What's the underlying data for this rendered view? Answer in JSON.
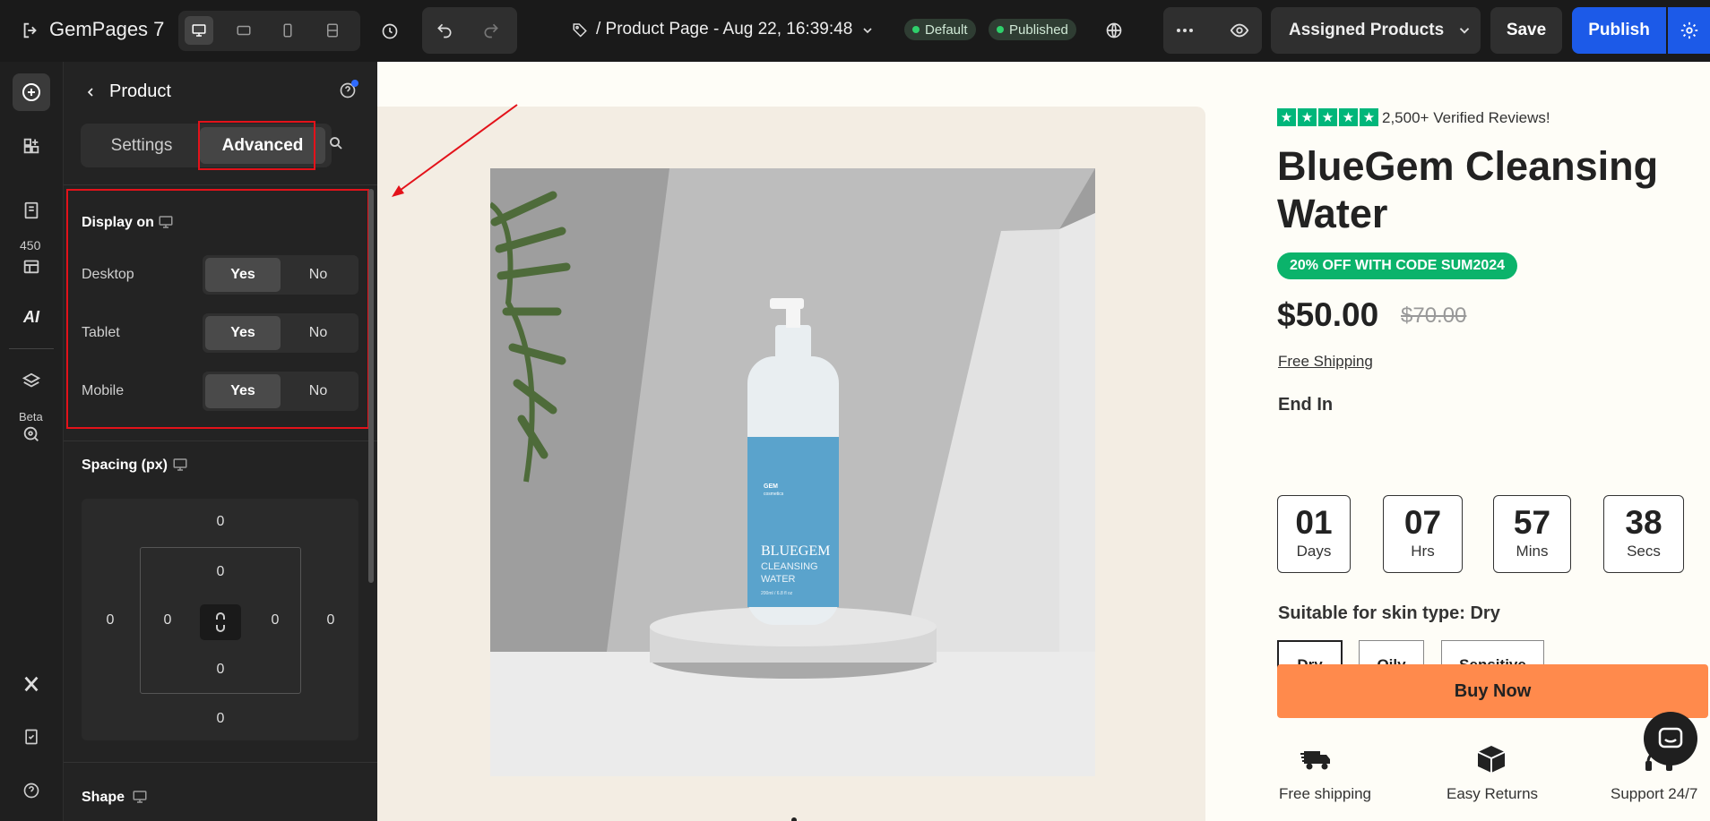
{
  "app": {
    "name": "GemPages 7"
  },
  "topbar": {
    "page_title": "/ Product Page - Aug 22, 16:39:48",
    "badge_default": "Default",
    "badge_published": "Published",
    "assigned_label": "Assigned Products",
    "save_label": "Save",
    "publish_label": "Publish"
  },
  "rail": {
    "count": "450",
    "ai_label": "AI",
    "beta_label": "Beta"
  },
  "panel": {
    "title": "Product",
    "tabs": [
      {
        "label": "Settings"
      },
      {
        "label": "Advanced"
      }
    ],
    "display_on": {
      "heading": "Display on",
      "rows": [
        {
          "label": "Desktop",
          "yes": "Yes",
          "no": "No",
          "selected": "Yes"
        },
        {
          "label": "Tablet",
          "yes": "Yes",
          "no": "No",
          "selected": "Yes"
        },
        {
          "label": "Mobile",
          "yes": "Yes",
          "no": "No",
          "selected": "Yes"
        }
      ]
    },
    "spacing": {
      "heading": "Spacing (px)",
      "margin": {
        "top": "0",
        "right": "0",
        "bottom": "0",
        "left": "0"
      },
      "padding": {
        "top": "0",
        "right": "0",
        "bottom": "0",
        "left": "0"
      }
    },
    "shape": {
      "heading": "Shape"
    }
  },
  "product": {
    "reviews": "2,500+ Verified Reviews!",
    "title": "BlueGem Cleansing Water",
    "promo_prefix": "20% OFF WITH CODE ",
    "promo_code": "SUM2024",
    "price": "$50.00",
    "compare_price": "$70.00",
    "free_shipping_link": "Free Shipping",
    "end_in": "End In",
    "countdown": [
      {
        "value": "01",
        "unit": "Days"
      },
      {
        "value": "07",
        "unit": "Hrs"
      },
      {
        "value": "57",
        "unit": "Mins"
      },
      {
        "value": "38",
        "unit": "Secs"
      }
    ],
    "variant_label": "Suitable for skin type: Dry",
    "variants": [
      "Dry",
      "Oily",
      "Sensitive"
    ],
    "buy_now": "Buy Now",
    "features": [
      {
        "label": "Free shipping",
        "icon": "truck-icon"
      },
      {
        "label": "Easy Returns",
        "icon": "box-icon"
      },
      {
        "label": "Support 24/7",
        "icon": "headset-icon"
      }
    ],
    "bottle_brand": "GEM",
    "bottle_brand_sub": "cosmetics",
    "bottle_line1": "BLUEGEM",
    "bottle_line2": "CLEANSING",
    "bottle_line3": "WATER",
    "bottle_volume": "200ml / 6.8 fl oz"
  },
  "colors": {
    "accent": "#1c5ae8",
    "promo": "#0bb36b",
    "buy": "#ff8a4c",
    "highlight": "#e3121a"
  }
}
